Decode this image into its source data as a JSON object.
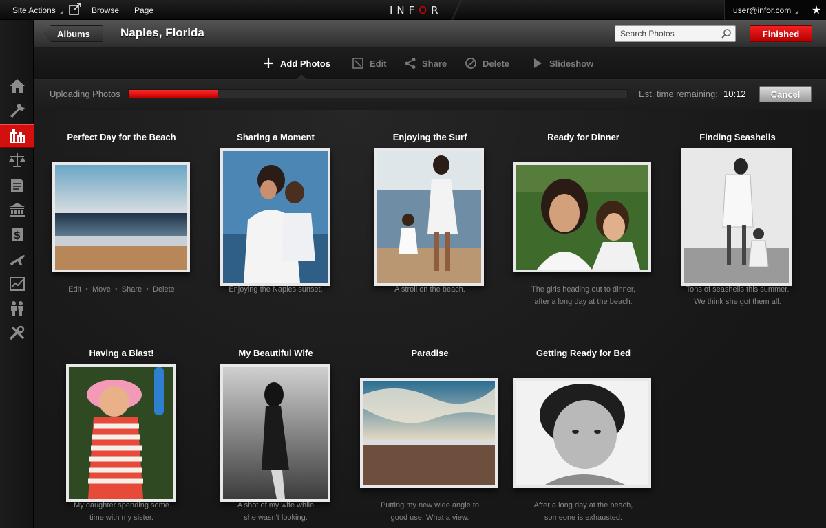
{
  "topbar": {
    "site_actions": "Site Actions",
    "browse": "Browse",
    "page": "Page",
    "logo": "INFOR",
    "user": "user@infor.com"
  },
  "header": {
    "albums_label": "Albums",
    "title": "Naples, Florida",
    "search_placeholder": "Search Photos",
    "finished_label": "Finished"
  },
  "toolbar": {
    "items": [
      {
        "label": "Add Photos",
        "icon": "plus-icon",
        "active": true
      },
      {
        "label": "Edit",
        "icon": "edit-icon",
        "active": false
      },
      {
        "label": "Share",
        "icon": "share-icon",
        "active": false
      },
      {
        "label": "Delete",
        "icon": "delete-icon",
        "active": false
      },
      {
        "label": "Slideshow",
        "icon": "play-icon",
        "active": false
      }
    ]
  },
  "upload": {
    "label": "Uploading Photos",
    "progress": 0.18,
    "est_label": "Est. time remaining:",
    "est_time": "10:12",
    "cancel_label": "Cancel"
  },
  "sidebar": {
    "icons": [
      "home-icon",
      "tools-icon",
      "building-icon",
      "scales-icon",
      "document-icon",
      "bank-icon",
      "dollar-icon",
      "plane-icon",
      "chart-icon",
      "people-icon",
      "wrench-icon"
    ],
    "active_index": 2
  },
  "photos": [
    {
      "title": "Perfect Day for the Beach",
      "caption_lines": [],
      "actions": [
        "Edit",
        "Move",
        "Share",
        "Delete"
      ],
      "subject": "beach-sunset-icon"
    },
    {
      "title": "Sharing a Moment",
      "caption_lines": [
        "Enjoying the Naples sunset."
      ],
      "subject": "mother-child-photo"
    },
    {
      "title": "Enjoying the Surf",
      "caption_lines": [
        "A stroll on the beach."
      ],
      "subject": "walking-beach-photo"
    },
    {
      "title": "Ready for Dinner",
      "caption_lines": [
        "The girls heading out to dinner,",
        "after a long day at the beach."
      ],
      "subject": "portrait-photo"
    },
    {
      "title": "Finding Seashells",
      "caption_lines": [
        "Tons of seashells this summer.",
        "We think she got them all."
      ],
      "subject": "seashells-photo"
    },
    {
      "title": "Having a Blast!",
      "caption_lines": [
        "My daughter spending some",
        "time with my sister."
      ],
      "subject": "child-hat-photo"
    },
    {
      "title": "My Beautiful Wife",
      "caption_lines": [
        "A shot of my wife while",
        "she wasn't looking."
      ],
      "subject": "silhouette-photo"
    },
    {
      "title": "Paradise",
      "caption_lines": [
        "Putting my new wide angle to",
        "good use. What a view."
      ],
      "subject": "wide-sky-photo"
    },
    {
      "title": "Getting Ready for Bed",
      "caption_lines": [
        "After a long day at the beach,",
        "someone is exhausted."
      ],
      "subject": "sleepy-child-photo"
    }
  ]
}
